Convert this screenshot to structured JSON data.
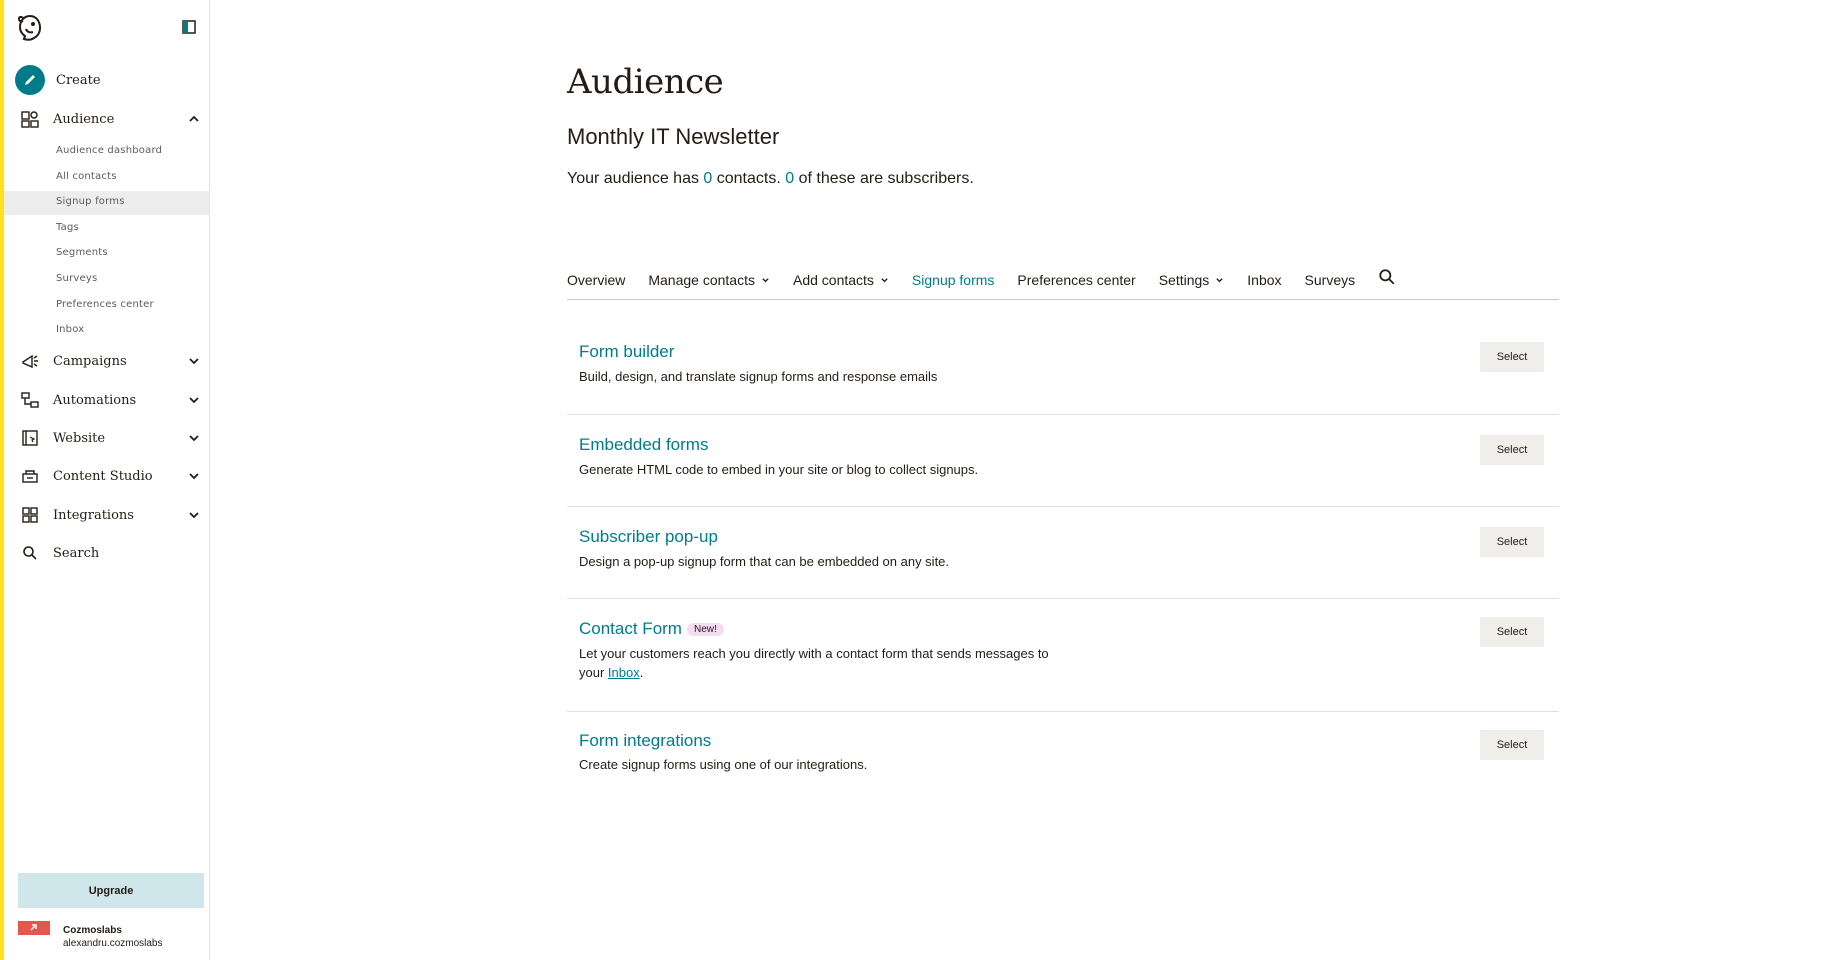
{
  "sidebar": {
    "create_label": "Create",
    "audience_label": "Audience",
    "audience_submenu": [
      "Audience dashboard",
      "All contacts",
      "Signup forms",
      "Tags",
      "Segments",
      "Surveys",
      "Preferences center",
      "Inbox"
    ],
    "campaigns_label": "Campaigns",
    "automations_label": "Automations",
    "website_label": "Website",
    "content_studio_label": "Content Studio",
    "integrations_label": "Integrations",
    "search_label": "Search",
    "upgrade_label": "Upgrade",
    "account_name": "Cozmoslabs",
    "account_user": "alexandru.cozmoslabs"
  },
  "header": {
    "title": "Audience",
    "audience_name": "Monthly IT Newsletter",
    "summary_prefix": "Your audience has ",
    "contacts_count": "0",
    "summary_middle": " contacts. ",
    "subscribers_count": "0",
    "summary_suffix": " of these are subscribers."
  },
  "tabs": [
    {
      "label": "Overview",
      "dropdown": false,
      "active": false
    },
    {
      "label": "Manage contacts",
      "dropdown": true,
      "active": false
    },
    {
      "label": "Add contacts",
      "dropdown": true,
      "active": false
    },
    {
      "label": "Signup forms",
      "dropdown": false,
      "active": true
    },
    {
      "label": "Preferences center",
      "dropdown": false,
      "active": false
    },
    {
      "label": "Settings",
      "dropdown": true,
      "active": false
    },
    {
      "label": "Inbox",
      "dropdown": false,
      "active": false
    },
    {
      "label": "Surveys",
      "dropdown": false,
      "active": false
    }
  ],
  "cards": [
    {
      "title": "Form builder",
      "desc": "Build, design, and translate signup forms and response emails",
      "button": "Select"
    },
    {
      "title": "Embedded forms",
      "desc": "Generate HTML code to embed in your site or blog to collect signups.",
      "button": "Select"
    },
    {
      "title": "Subscriber pop-up",
      "desc": "Design a pop-up signup form that can be embedded on any site.",
      "button": "Select"
    },
    {
      "title": "Contact Form",
      "badge": "New!",
      "desc_line1": "Let your customers reach you directly with a contact form that sends messages to",
      "desc_line2_prefix": "your ",
      "desc_link": "Inbox",
      "desc_line2_suffix": ".",
      "button": "Select"
    },
    {
      "title": "Form integrations",
      "desc": "Create signup forms using one of our integrations.",
      "button": "Select"
    }
  ],
  "colors": {
    "accent": "#007c89",
    "edge": "#ffe01b",
    "upgrade_bg": "#cfe6ea",
    "badge_bg": "#f5dcf2"
  }
}
